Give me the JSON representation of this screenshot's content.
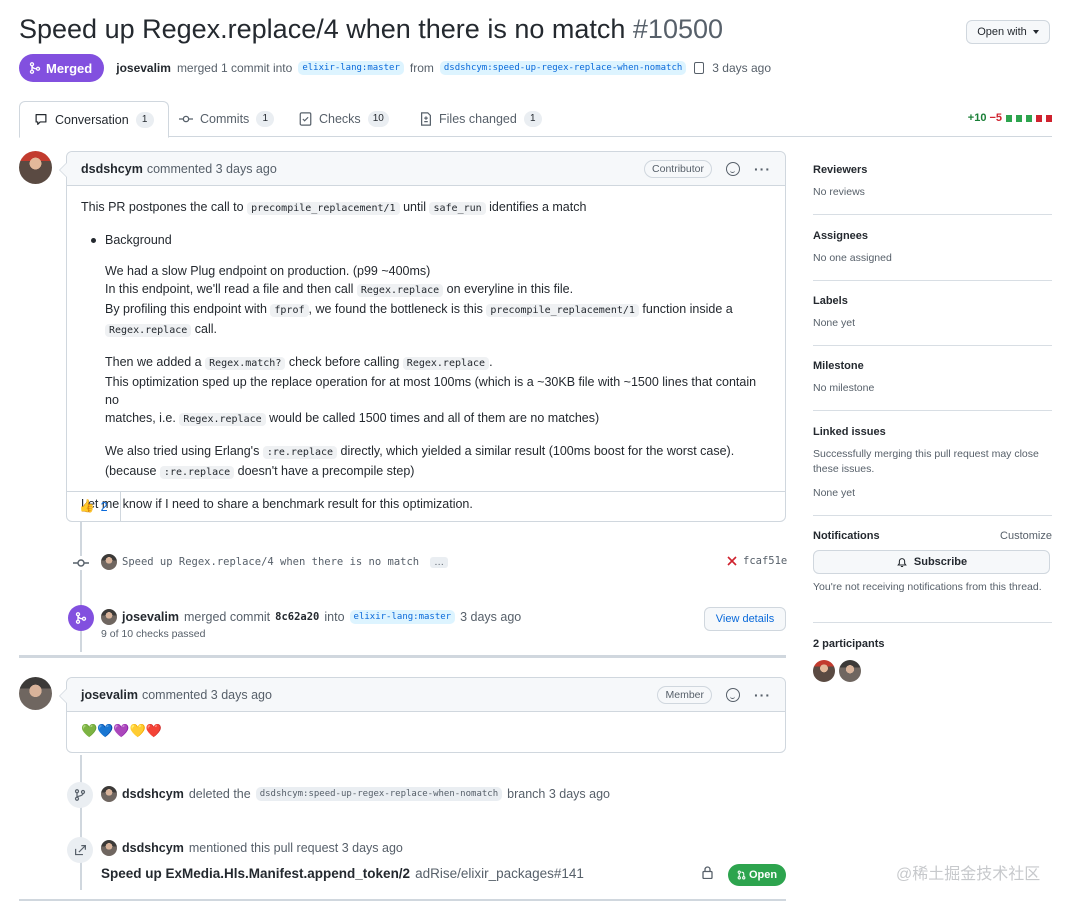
{
  "header": {
    "title": "Speed up Regex.replace/4 when there is no match",
    "number": "#10500",
    "open_with": "Open with",
    "status": "Merged",
    "author": "josevalim",
    "merge_text": "merged 1 commit into",
    "base_branch": "elixir-lang:master",
    "from_text": "from",
    "head_branch": "dsdshcym:speed-up-regex-replace-when-nomatch",
    "time": "3 days ago"
  },
  "tabs": [
    {
      "label": "Conversation",
      "count": "1"
    },
    {
      "label": "Commits",
      "count": "1"
    },
    {
      "label": "Checks",
      "count": "10"
    },
    {
      "label": "Files changed",
      "count": "1"
    }
  ],
  "diffstat": {
    "additions": "+10",
    "deletions": "−5"
  },
  "comment1": {
    "author": "dsdshcym",
    "action": "commented 3 days ago",
    "role": "Contributor",
    "p1_a": "This PR postpones the call to",
    "p1_code1": "precompile_replacement/1",
    "p1_b": "until",
    "p1_code2": "safe_run",
    "p1_c": "identifies a match",
    "bullet": "Background",
    "b1_l1": "We had a slow Plug endpoint on production. (p99 ~400ms)",
    "b1_l2a": "In this endpoint, we'll read a file and then call",
    "b1_l2code": "Regex.replace",
    "b1_l2b": "on everyline in this file.",
    "b1_l3a": "By profiling this endpoint with",
    "b1_l3code1": "fprof",
    "b1_l3b": ", we found the bottleneck is this",
    "b1_l3code2": "precompile_replacement/1",
    "b1_l3c": "function inside a",
    "b1_l4code": "Regex.replace",
    "b1_l4b": "call.",
    "b2_l1a": "Then we added a",
    "b2_l1code1": "Regex.match?",
    "b2_l1b": "check before calling",
    "b2_l1code2": "Regex.replace",
    "b2_l1c": ".",
    "b2_l2": "This optimization sped up the replace operation for at most 100ms (which is a ~30KB file with ~1500 lines that contain no",
    "b2_l3a": "matches, i.e.",
    "b2_l3code": "Regex.replace",
    "b2_l3b": "would be called 1500 times and all of them are no matches)",
    "b3_l1a": "We also tried using Erlang's",
    "b3_l1code": ":re.replace",
    "b3_l1b": "directly, which yielded a similar result (100ms boost for the worst case).",
    "b3_l2a": "(because",
    "b3_l2code": ":re.replace",
    "b3_l2b": "doesn't have a precompile step)",
    "closing": "Let me know if I need to share a benchmark result for this optimization.",
    "reaction_emoji": "👍",
    "reaction_count": "2"
  },
  "commit_event": {
    "message": "Speed up Regex.replace/4 when there is no match",
    "ellipsis": "…",
    "status_icon": "x-icon",
    "sha": "fcaf51e"
  },
  "merge_event": {
    "author": "josevalim",
    "text": "merged commit",
    "sha": "8c62a20",
    "into": "into",
    "branch": "elixir-lang:master",
    "time": "3 days ago",
    "checks": "9 of 10 checks passed",
    "view_details": "View details"
  },
  "comment2": {
    "author": "josevalim",
    "action": "commented 3 days ago",
    "role": "Member",
    "hearts": "💚💙💜💛❤️"
  },
  "delete_event": {
    "author": "dsdshcym",
    "text": "deleted the",
    "branch": "dsdshcym:speed-up-regex-replace-when-nomatch",
    "suffix": "branch 3 days ago"
  },
  "mention_event": {
    "author": "dsdshcym",
    "text": "mentioned this pull request 3 days ago",
    "ref_title": "Speed up ExMedia.Hls.Manifest.append_token/2",
    "ref_repo": "adRise/elixir_packages#141",
    "ref_status": "Open"
  },
  "sidebar": {
    "reviewers_title": "Reviewers",
    "reviewers_value": "No reviews",
    "assignees_title": "Assignees",
    "assignees_value": "No one assigned",
    "labels_title": "Labels",
    "labels_value": "None yet",
    "milestone_title": "Milestone",
    "milestone_value": "No milestone",
    "linked_title": "Linked issues",
    "linked_desc": "Successfully merging this pull request may close these issues.",
    "linked_value": "None yet",
    "notif_title": "Notifications",
    "notif_customize": "Customize",
    "subscribe": "Subscribe",
    "notif_desc": "You're not receiving notifications from this thread.",
    "participants_title": "2 participants"
  },
  "watermark": "@稀土掘金技术社区",
  "colors": {
    "merged": "#8250df",
    "link": "#0969da",
    "open": "#2da44e",
    "add": "#1a7f37",
    "del": "#cf222e"
  }
}
